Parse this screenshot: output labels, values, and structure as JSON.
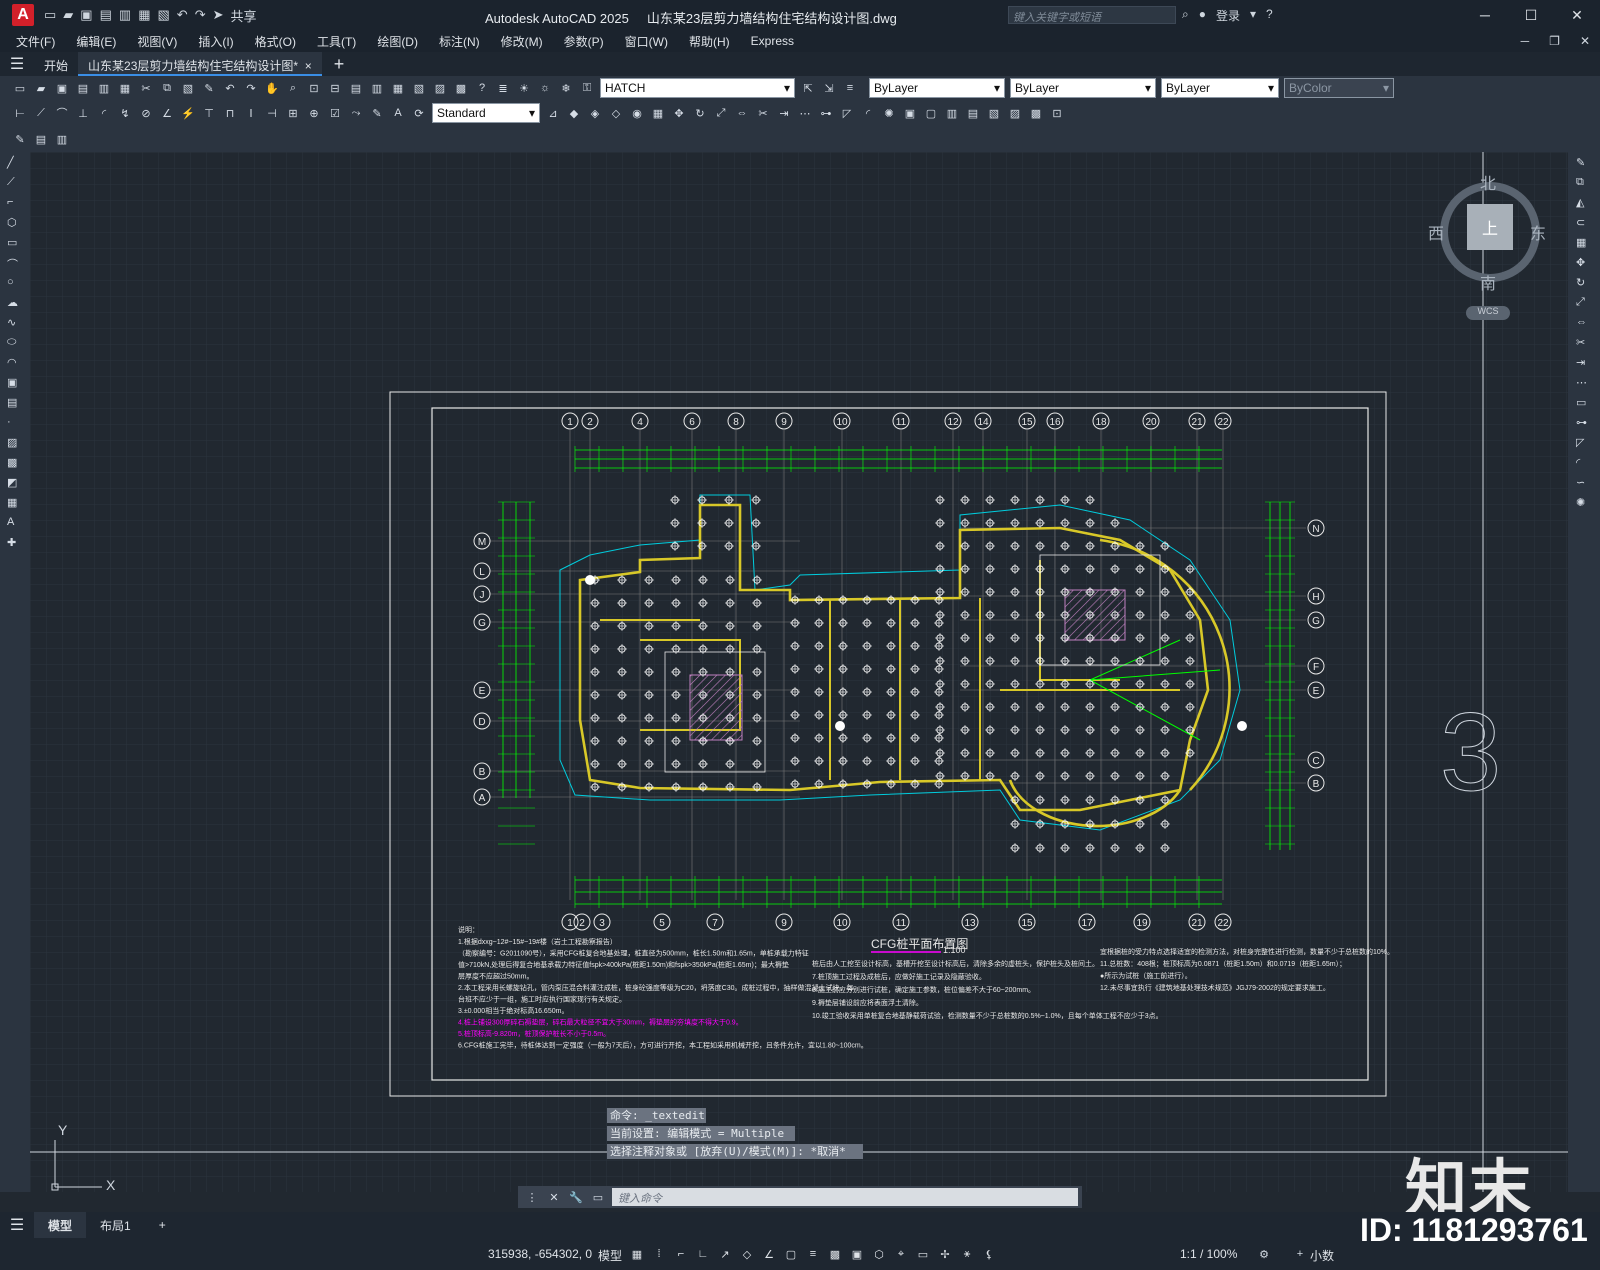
{
  "app": {
    "logo": "A",
    "title": "Autodesk AutoCAD 2025",
    "filename": "山东某23层剪力墙结构住宅结构设计图.dwg",
    "share_label": "共享",
    "search_placeholder": "键入关键字或短语",
    "login_label": "登录"
  },
  "menus": [
    "文件(F)",
    "编辑(E)",
    "视图(V)",
    "插入(I)",
    "格式(O)",
    "工具(T)",
    "绘图(D)",
    "标注(N)",
    "修改(M)",
    "参数(P)",
    "窗口(W)",
    "帮助(H)",
    "Express"
  ],
  "tabs": {
    "start": "开始",
    "active": "山东某23层剪力墙结构住宅结构设计图*"
  },
  "toolbar": {
    "layer_name": "HATCH",
    "color": "ByLayer",
    "linetype": "ByLayer",
    "lineweight": "ByLayer",
    "plotstyle": "ByColor",
    "dimstyle": "Standard"
  },
  "viewcube": {
    "north": "北",
    "south": "南",
    "east": "东",
    "west": "西",
    "top": "上",
    "wcs": "WCS"
  },
  "drawing": {
    "title": "CFG桩平面布置图",
    "scale": "1:100",
    "big_number": "3",
    "top_axes": [
      "1",
      "2",
      "4",
      "6",
      "8",
      "9",
      "10",
      "11",
      "12",
      "14",
      "15",
      "16",
      "18",
      "20",
      "21",
      "22"
    ],
    "bottom_axes": [
      "1",
      "2",
      "3",
      "5",
      "7",
      "9",
      "10",
      "11",
      "13",
      "15",
      "17",
      "19",
      "21",
      "22"
    ],
    "left_axes": [
      "M",
      "L",
      "J",
      "G",
      "E",
      "D",
      "B",
      "A"
    ],
    "right_axes": [
      "N",
      "H",
      "G",
      "F",
      "E",
      "C",
      "B"
    ],
    "notes_left_heading": "说明：",
    "notes_left": [
      "1.根据dxxg~12#~15#~19#楼（岩土工程勘察报告）",
      "（勘察编号：G2011090号），采用CFG桩复合地基处理，桩直径为500mm，桩长1.50m和1.65m，单桩承载力特征",
      "值>710kN,处理后得复合地基承载力特征值fspk>400kPa(桩距1.50m)和fspk>350kPa(桩距1.65m)；最大褥垫",
      "层厚度不应超过50mm。",
      "2.本工程采用长螺旋钻孔，管内泵压混合料灌注成桩，桩身砼强度等级为C20，坍落度C30。成桩过程中，抽样做混凝土试块，每",
      "台班不应少于一组，施工时应执行国家现行有关规定。",
      "3.±0.000相当于绝对标高16.650m。",
      "4.桩上铺设300厚碎石褥垫层，碎石最大粒径不宜大于30mm，褥垫层的夯填度不得大于0.9。",
      "5.桩顶标高-9.820m，桩顶保护桩长不小于0.5m。",
      "6.CFG桩施工完毕，待桩体达到一定强度（一般为7天后），方可进行开挖，本工程如采用机械开挖，且条件允许，宜以1.80~100cm。"
    ],
    "notes_mid": [
      "桩后由人工挖至设计标高，基槽开挖至设计标高后，清除多余的虚桩头，保护桩头及桩间土。",
      "7.桩顶施工过程及成桩后，应做好施工记录及隐蔽验收。",
      "8.施工前应分别进行试桩，确定施工参数，桩位偏差不大于60~200mm。",
      "9.褥垫层铺设前应将表面浮土清除。",
      "10.竣工验收采用单桩复合地基静载荷试验，检测数量不少于总桩数的0.5%~1.0%，且每个单体工程不应少于3点。"
    ],
    "notes_right": [
      "宜根据桩的受力特点选择适宜的检测方法，对桩身完整性进行检测，数量不少于总桩数的10%。",
      "11.总桩数：408根；桩顶标高为0.0871（桩距1.50m）和0.0719（桩距1.65m）；",
      "●所示为试桩（施工前进行）。",
      "12.未尽事宜执行《建筑地基处理技术规范》JGJ79-2002的规定要求施工。"
    ]
  },
  "command": {
    "history": [
      "命令: _textedit",
      "当前设置: 编辑模式 = Multiple",
      "选择注释对象或 [放弃(U)/模式(M)]: *取消*"
    ],
    "placeholder": "键入命令"
  },
  "layouts": [
    "模型",
    "布局1"
  ],
  "status": {
    "coords": "315938, -654302, 0",
    "model": "模型",
    "annotation_scale": "1:1 / 100%",
    "units": "小数"
  },
  "watermark": {
    "brand": "知末",
    "id": "ID: 1181293761"
  },
  "colors": {
    "ui_dark": "#1b232d",
    "toolbar": "#2b3440",
    "model_space": "#212830",
    "axis_line": "#00ff00",
    "wall": "#d8c828",
    "pile": "#ffffff",
    "cyan": "#00ccdd",
    "magenta": "#ff00ff"
  }
}
